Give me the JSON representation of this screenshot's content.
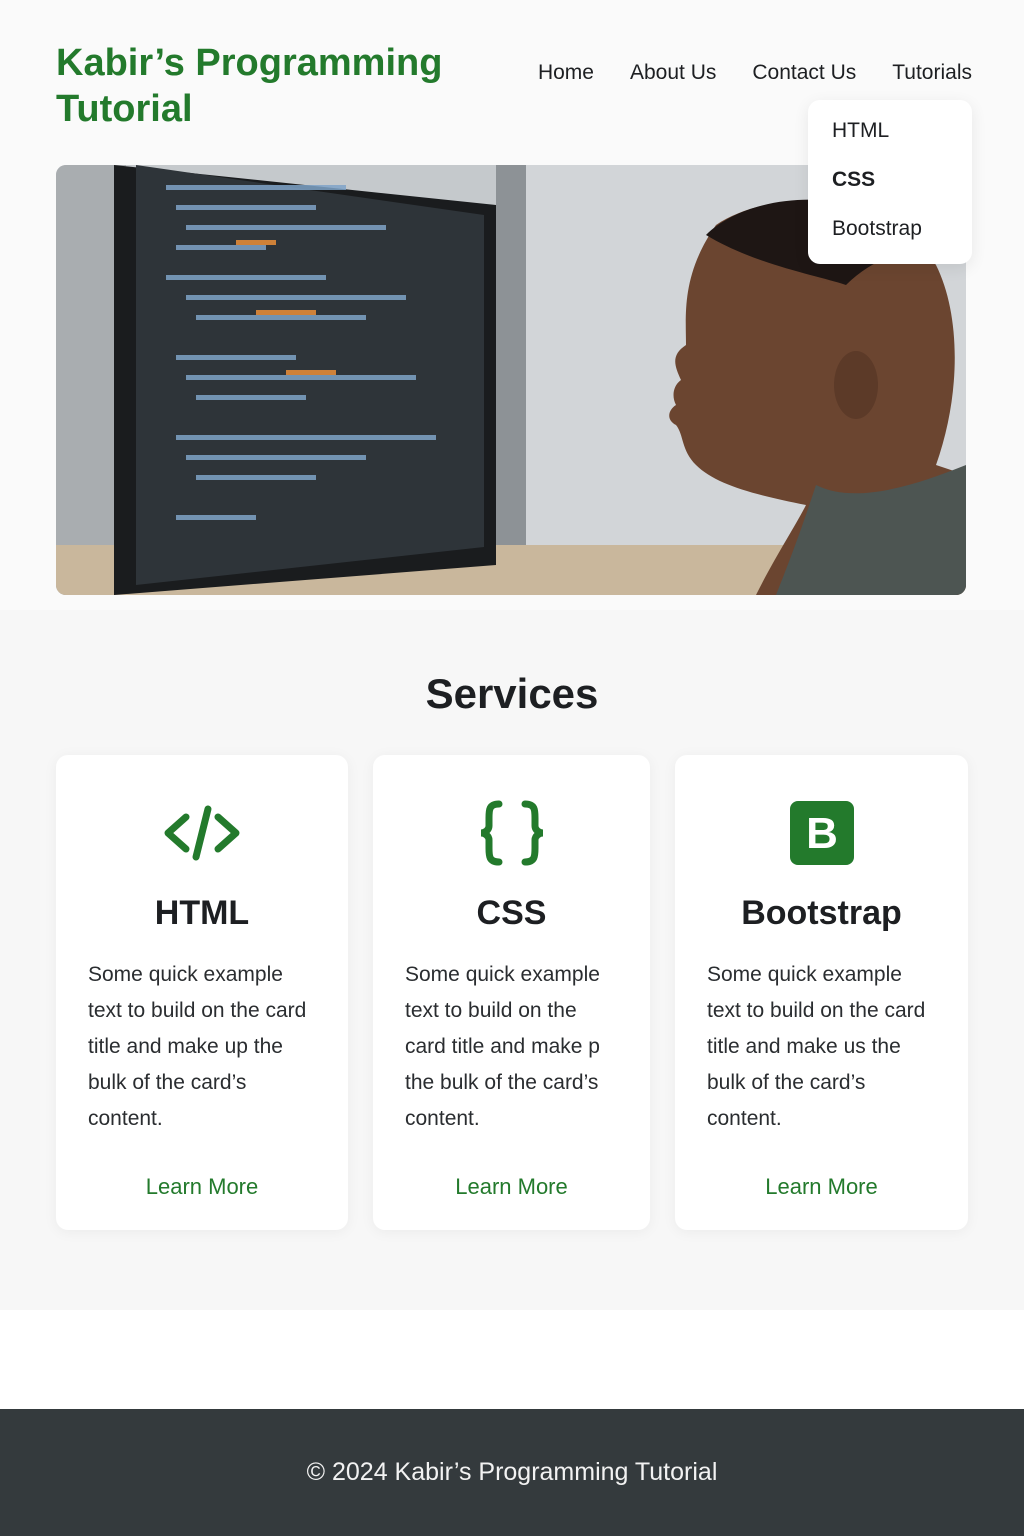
{
  "header": {
    "brand": "Kabir’s Programming Tutorial",
    "nav": [
      "Home",
      "About Us",
      "Contact Us",
      "Tutorials"
    ]
  },
  "dropdown": {
    "items": [
      "HTML",
      "CSS",
      "Bootstrap"
    ],
    "active": "CSS"
  },
  "hero": {
    "alt_subject": "coding-monitor-and-child"
  },
  "services": {
    "title": "Services",
    "cards": [
      {
        "icon": "code-icon",
        "title": "HTML",
        "text": "Some quick example text to build on the card title and make up the bulk of the card’s content.",
        "link": "Learn More"
      },
      {
        "icon": "braces-icon",
        "title": "CSS",
        "text": "Some quick example text to build on the card title and make p the bulk of the card’s content.",
        "link": "Learn More"
      },
      {
        "icon": "bootstrap-icon",
        "title": "Bootstrap",
        "text": "Some quick example text to build on the card title and make us the bulk of the card’s content.",
        "link": "Learn More"
      }
    ]
  },
  "footer": {
    "text": "© 2024 Kabir’s Programming Tutorial"
  },
  "colors": {
    "accent": "#237a2c",
    "footer_bg": "#343a3d"
  }
}
